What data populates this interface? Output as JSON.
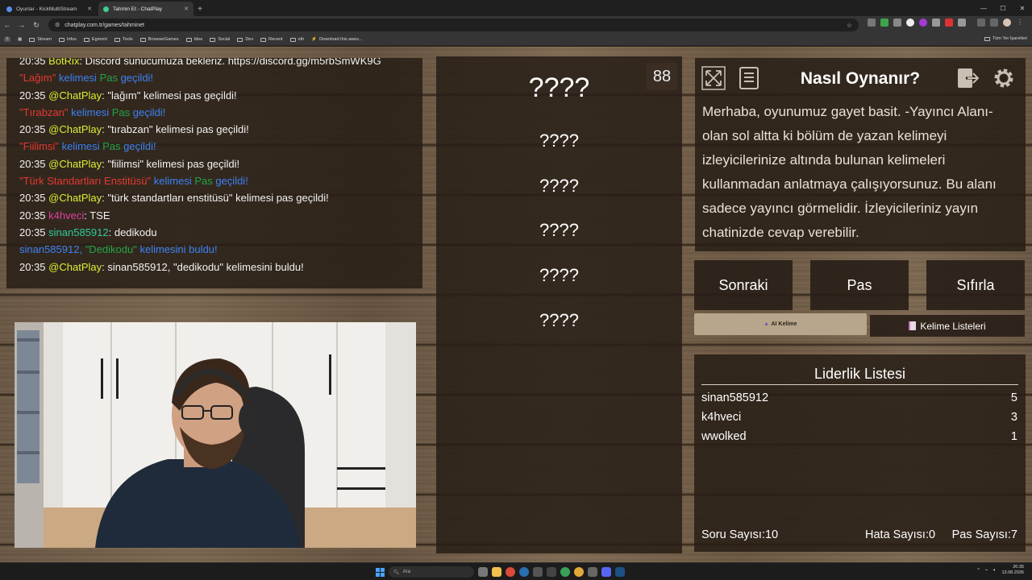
{
  "browser": {
    "tabs": [
      {
        "title": "Oyunlar - KickMultiStream",
        "active": false
      },
      {
        "title": "Tahmin Et - ChatPlay",
        "active": true
      }
    ],
    "url": "chatplay.com.tr/games/tahminet",
    "bookmarks": [
      "Stream",
      "Infos",
      "Egmont",
      "Tools",
      "BrowserGames",
      "Idee",
      "Social",
      "Dev",
      "Recent",
      "oth",
      "Download this awes..."
    ],
    "bookmarks_right": "Tüm Yer İşaretleri"
  },
  "chat": {
    "lines": [
      [
        {
          "t": "20:35 ",
          "c": ""
        },
        {
          "t": "BotRix",
          "c": "yellow"
        },
        {
          "t": ": Discord sunucumuza bekleriz. https://discord.gg/m5rbSmWK9G",
          "c": ""
        }
      ],
      [
        {
          "t": "\"Lağım\" ",
          "c": "red"
        },
        {
          "t": "kelimesi ",
          "c": "blue"
        },
        {
          "t": "Pas ",
          "c": "green"
        },
        {
          "t": "geçildi!",
          "c": "blue"
        }
      ],
      [
        {
          "t": "20:35 ",
          "c": ""
        },
        {
          "t": "@ChatPlay",
          "c": "yellow"
        },
        {
          "t": ": \"lağım\" kelimesi pas geçildi!",
          "c": ""
        }
      ],
      [
        {
          "t": "\"Tırabzan\" ",
          "c": "red"
        },
        {
          "t": "kelimesi ",
          "c": "blue"
        },
        {
          "t": "Pas ",
          "c": "green"
        },
        {
          "t": "geçildi!",
          "c": "blue"
        }
      ],
      [
        {
          "t": "20:35 ",
          "c": ""
        },
        {
          "t": "@ChatPlay",
          "c": "yellow"
        },
        {
          "t": ": \"tırabzan\" kelimesi pas geçildi!",
          "c": ""
        }
      ],
      [
        {
          "t": "\"Fiilimsi\" ",
          "c": "red"
        },
        {
          "t": "kelimesi ",
          "c": "blue"
        },
        {
          "t": "Pas ",
          "c": "green"
        },
        {
          "t": "geçildi!",
          "c": "blue"
        }
      ],
      [
        {
          "t": "20:35 ",
          "c": ""
        },
        {
          "t": "@ChatPlay",
          "c": "yellow"
        },
        {
          "t": ": \"fiilimsi\" kelimesi pas geçildi!",
          "c": ""
        }
      ],
      [
        {
          "t": "\"Türk Standartları Enstitüsü\" ",
          "c": "red"
        },
        {
          "t": "kelimesi ",
          "c": "blue"
        },
        {
          "t": "Pas ",
          "c": "green"
        },
        {
          "t": "geçildi!",
          "c": "blue"
        }
      ],
      [
        {
          "t": "20:35 ",
          "c": ""
        },
        {
          "t": "@ChatPlay",
          "c": "yellow"
        },
        {
          "t": ": \"türk standartları enstitüsü\" kelimesi pas geçildi!",
          "c": ""
        }
      ],
      [
        {
          "t": "20:35 ",
          "c": ""
        },
        {
          "t": "k4hveci",
          "c": "pink"
        },
        {
          "t": ": TSE",
          "c": ""
        }
      ],
      [
        {
          "t": "20:35 ",
          "c": ""
        },
        {
          "t": "sinan585912",
          "c": "teal"
        },
        {
          "t": ": dedikodu",
          "c": ""
        }
      ],
      [
        {
          "t": "sinan585912, ",
          "c": "blue"
        },
        {
          "t": "\"Dedikodu\" ",
          "c": "green"
        },
        {
          "t": "kelimesini buldu!",
          "c": "blue"
        }
      ],
      [
        {
          "t": "20:35 ",
          "c": ""
        },
        {
          "t": "@ChatPlay",
          "c": "yellow"
        },
        {
          "t": ": sinan585912, \"dedikodu\" kelimesini buldu!",
          "c": ""
        }
      ]
    ]
  },
  "game": {
    "counter": "88",
    "words": [
      "????",
      "????",
      "????",
      "????",
      "????",
      "????"
    ]
  },
  "howto": {
    "title": "Nasıl Oynanır?",
    "text": "Merhaba, oyunumuz gayet basit. -Yayıncı Alanı- olan sol altta ki bölüm de yazan kelimeyi izleyicilerinize altında bulunan kelimeleri kullanmadan anlatmaya çalışıyorsunuz. Bu alanı sadece yayıncı görmelidir. İzleyicileriniz yayın chatinizde cevap verebilir."
  },
  "controls": {
    "next": "Sonraki",
    "pass": "Pas",
    "reset": "Sıfırla",
    "ai_word": "AI Kelime",
    "word_lists": "Kelime Listeleri"
  },
  "leaderboard": {
    "title": "Liderlik Listesi",
    "rows": [
      {
        "name": "sinan585912",
        "score": "5"
      },
      {
        "name": "k4hveci",
        "score": "3"
      },
      {
        "name": "wwolked",
        "score": "1"
      }
    ],
    "question_count_label": "Soru Sayısı:",
    "question_count": "10",
    "error_count_label": "Hata Sayısı:",
    "error_count": "0",
    "pass_count_label": "Pas Sayısı:",
    "pass_count": "7"
  },
  "colors": {
    "yellow": "#d8f034",
    "red": "#e53935",
    "blue": "#3b82f6",
    "green": "#22a447",
    "pink": "#e040a0",
    "teal": "#2ecc9a"
  },
  "taskbar": {
    "search_placeholder": "Ara",
    "time": "20:35",
    "date": "13.08.2026"
  }
}
